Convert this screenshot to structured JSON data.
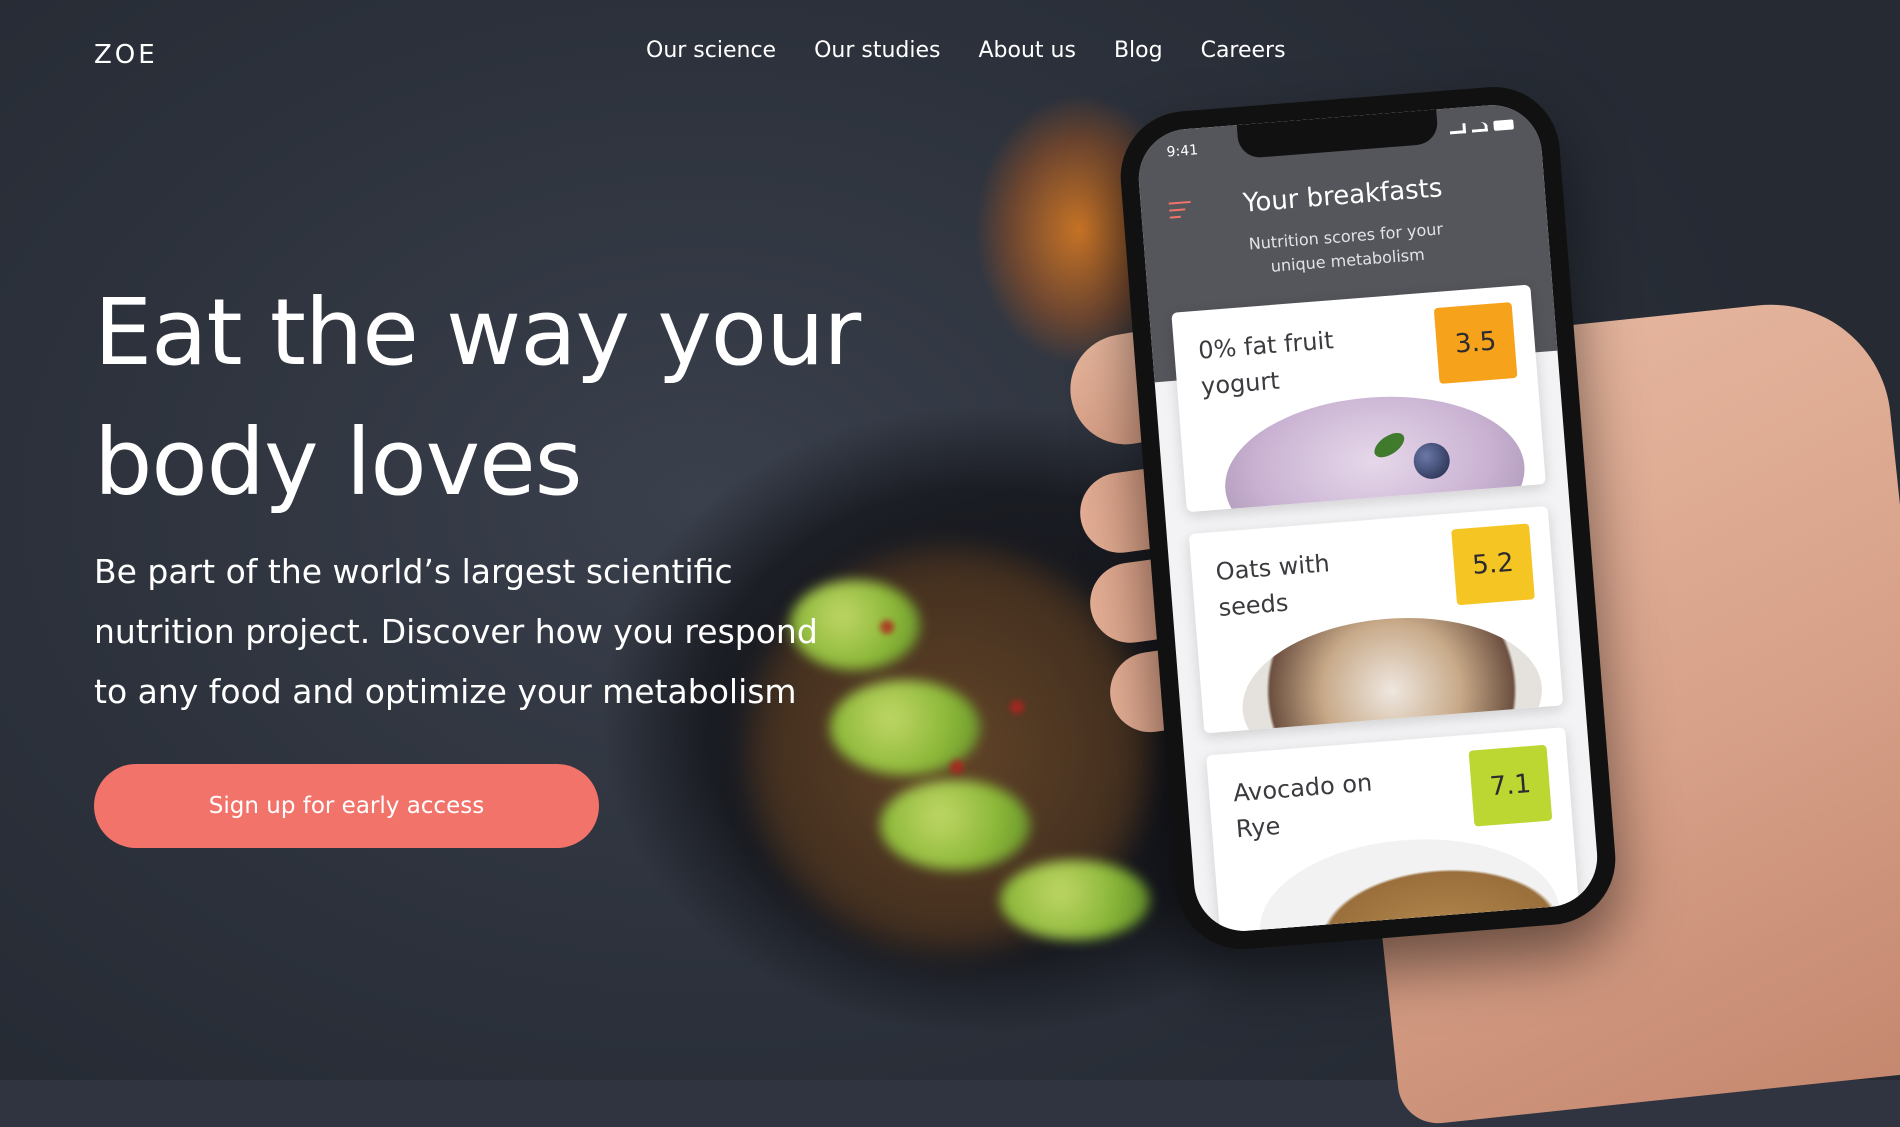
{
  "brand": {
    "logo": "ZOE"
  },
  "nav": {
    "items": [
      "Our science",
      "Our studies",
      "About us",
      "Blog",
      "Careers"
    ]
  },
  "hero": {
    "title_line1": "Eat the way your",
    "title_line2": "body loves",
    "subtitle_line1": "Be part of the world’s largest scientific",
    "subtitle_line2": "nutrition project. Discover how you respond",
    "subtitle_line3": "to any food and optimize your metabolism",
    "cta_label": "Sign up for early access"
  },
  "phone": {
    "status_time": "9:41",
    "app_title": "Your breakfasts",
    "app_subtitle_line1": "Nutrition scores for your",
    "app_subtitle_line2": "unique metabolism",
    "cards": [
      {
        "name": "0% fat fruit yogurt",
        "score": "3.5",
        "score_color": "#f7a21b"
      },
      {
        "name": "Oats with seeds",
        "score": "5.2",
        "score_color": "#f5c523"
      },
      {
        "name": "Avocado on Rye",
        "score": "7.1",
        "score_color": "#bcd632"
      }
    ]
  },
  "colors": {
    "accent": "#f2736a",
    "background": "#2f3440"
  }
}
